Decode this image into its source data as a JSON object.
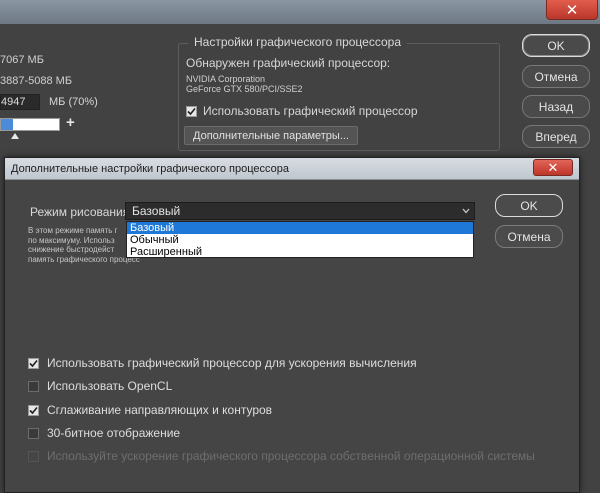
{
  "bg": {
    "mem_available": "7067 МБ",
    "mem_ideal_range": "3887-5088 МБ",
    "mem_value": "4947",
    "mem_unit_pct": "МБ (70%)",
    "slider_fraction": 0.7,
    "slider_plus": "+",
    "close_glyph": "✕",
    "gpu_group_title": "Настройки графического процессора",
    "gpu_detected_label": "Обнаружен графический процессор:",
    "gpu_vendor": "NVIDIA Corporation",
    "gpu_model": "GeForce GTX 580/PCI/SSE2",
    "use_gpu_label": "Использовать графический процессор",
    "use_gpu_checked": true,
    "advanced_button": "Дополнительные параметры...",
    "buttons": {
      "ok": "OK",
      "cancel": "Отмена",
      "back": "Назад",
      "forward": "Вперед"
    }
  },
  "dialog": {
    "title": "Дополнительные настройки графического процессора",
    "close_glyph": "✕",
    "draw_mode_label": "Режим рисования:",
    "draw_mode_value": "Базовый",
    "draw_mode_options": [
      "Базовый",
      "Обычный",
      "Расширенный"
    ],
    "draw_mode_selected_index": 0,
    "description_lines": [
      "В этом режиме память г",
      "по максимуму.  Использ",
      "снижение быстродейст",
      "память графического процессора."
    ],
    "ok_button": "OK",
    "cancel_button": "Отмена",
    "options": [
      {
        "label": "Использовать графический процессор для ускорения вычисления",
        "checked": true,
        "disabled": false
      },
      {
        "label": "Использовать OpenCL",
        "checked": false,
        "disabled": false
      },
      {
        "label": "Сглаживание направляющих и контуров",
        "checked": true,
        "disabled": false
      },
      {
        "label": "30-битное отображение",
        "checked": false,
        "disabled": false
      },
      {
        "label": "Используйте ускорение графического процессора собственной операционной системы",
        "checked": false,
        "disabled": true
      }
    ]
  },
  "colors": {
    "selection": "#1e78d7",
    "slider_fill": "#4b8bd8",
    "close_red": "#c7392c"
  }
}
